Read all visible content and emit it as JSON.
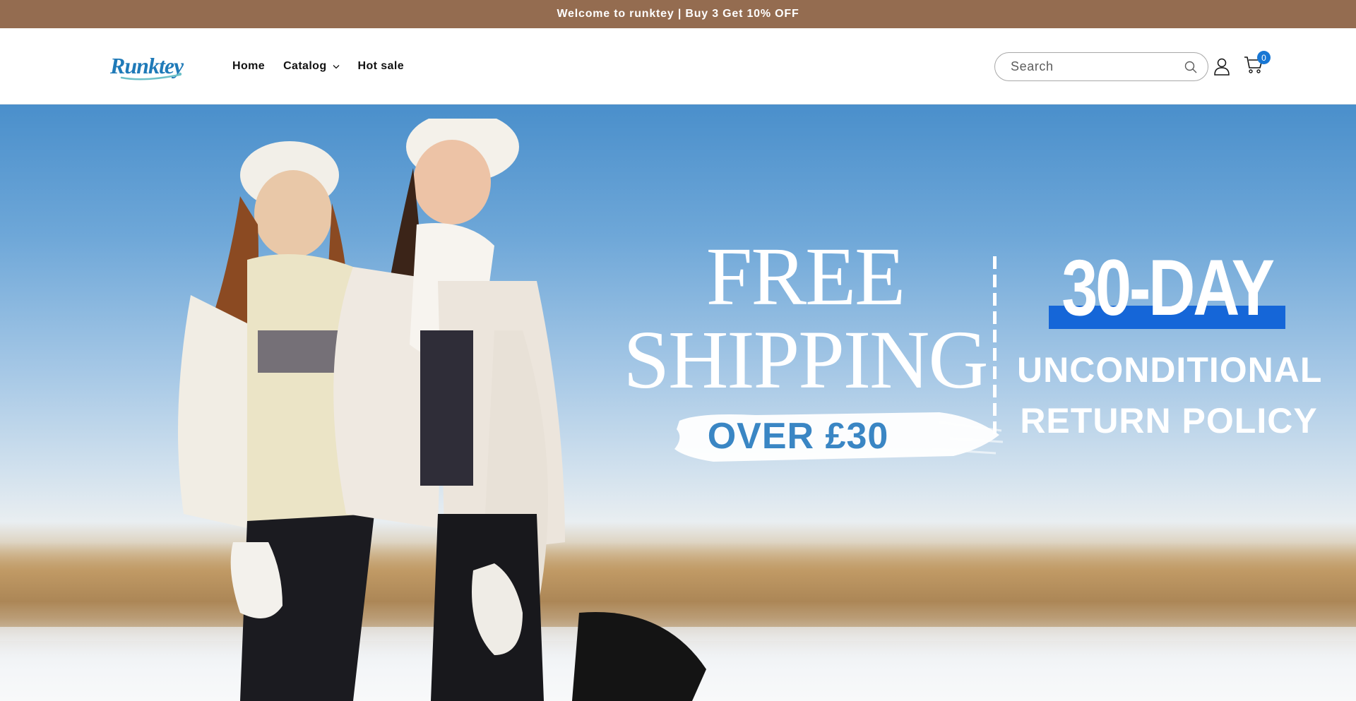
{
  "announcement": {
    "text": "Welcome to runktey | Buy 3 Get 10% OFF"
  },
  "header": {
    "logo_text": "Runktey",
    "nav": [
      {
        "label": "Home"
      },
      {
        "label": "Catalog",
        "has_dropdown": true
      },
      {
        "label": "Hot sale"
      }
    ],
    "search": {
      "placeholder": "Search",
      "value": ""
    },
    "cart_count": "0"
  },
  "hero": {
    "free_line1": "FREE",
    "free_line2": "SHIPPING",
    "over_text": "OVER £30",
    "day_text": "30-DAY",
    "policy_line1": "UNCONDITIONAL",
    "policy_line2": "RETURN POLICY"
  },
  "colors": {
    "announcement_bg": "#946c50",
    "accent_blue": "#1566d8",
    "badge_blue": "#1877d4",
    "logo_blue": "#1f7ab8",
    "over_text_blue": "#3a86c4"
  },
  "icons": [
    "search-icon",
    "account-icon",
    "cart-icon",
    "chevron-down-icon"
  ]
}
